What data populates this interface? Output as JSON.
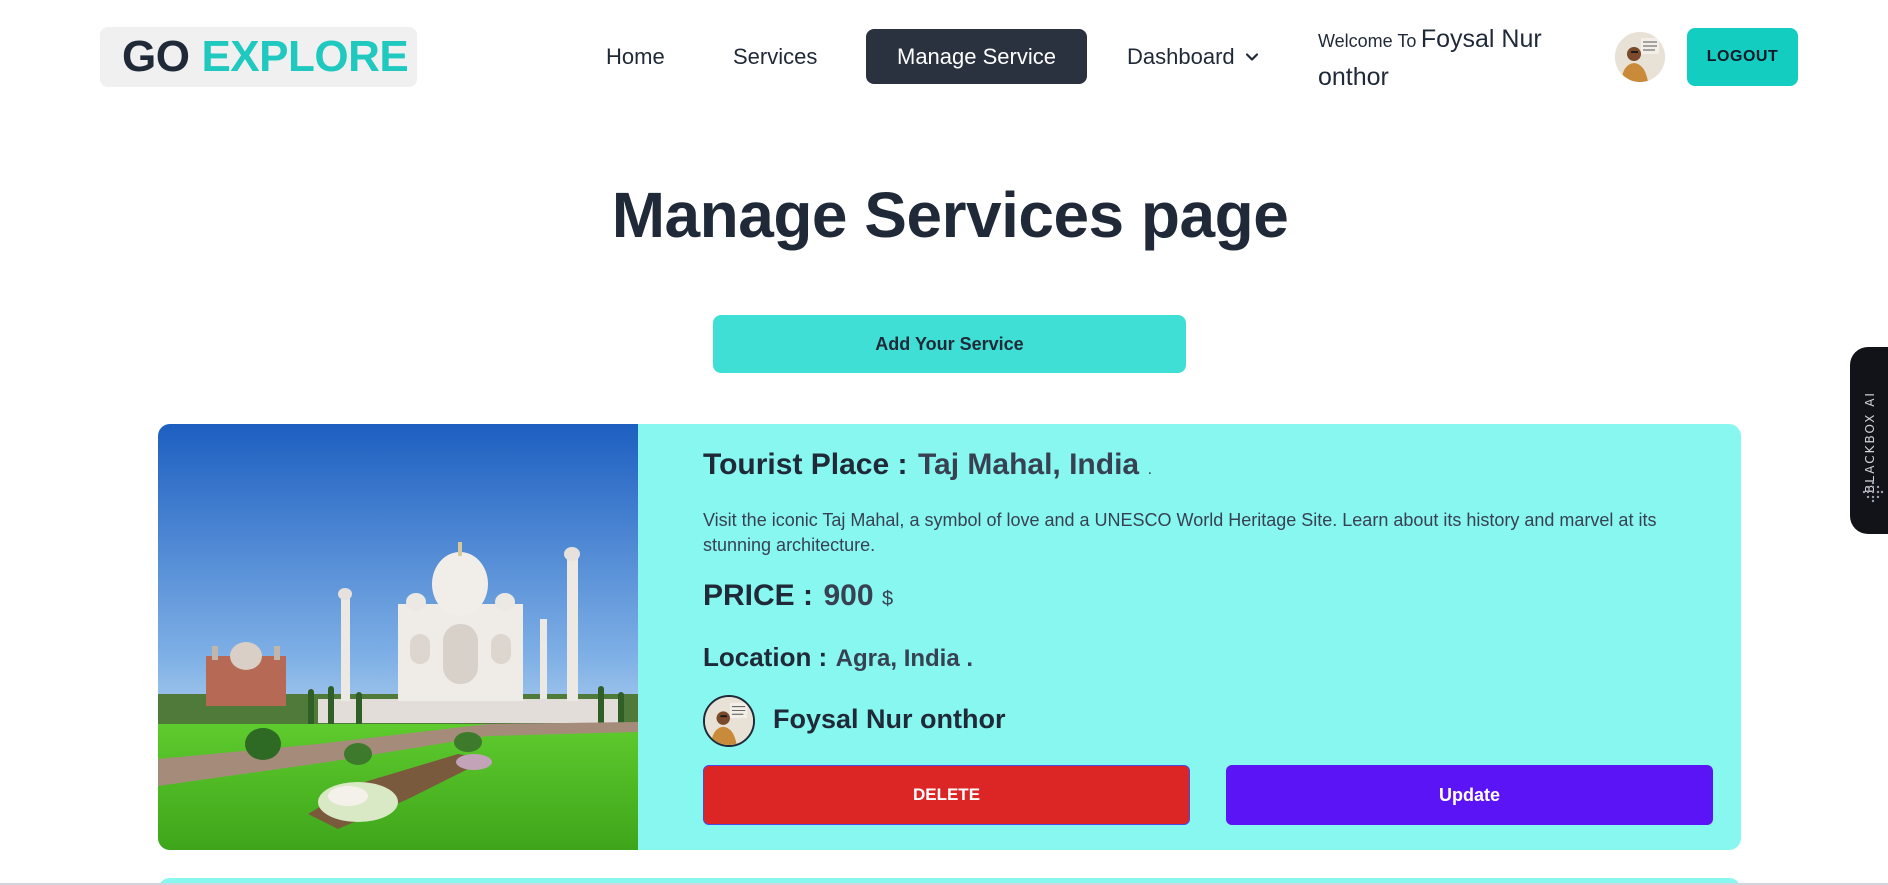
{
  "header": {
    "logo": {
      "part1": "GO",
      "part2": "EXPLORE"
    },
    "nav": [
      {
        "label": "Home"
      },
      {
        "label": "Services"
      },
      {
        "label": "Manage Service"
      },
      {
        "label": "Dashboard"
      }
    ],
    "welcome": {
      "prefix": "Welcome To",
      "user": "Foysal Nur onthor"
    },
    "logout_label": "LOGOUT"
  },
  "page": {
    "title": "Manage Services page",
    "add_button": "Add Your Service"
  },
  "service": {
    "place_label": "Tourist Place :",
    "place_value": "Taj Mahal, India",
    "place_suffix": ".",
    "description": "Visit the iconic Taj Mahal, a symbol of love and a UNESCO World Heritage Site. Learn about its history and marvel at its stunning architecture.",
    "price_label": "PRICE :",
    "price_value": "900",
    "price_unit": "$",
    "location_label": "Location :",
    "location_value": "Agra, India .",
    "owner_name": "Foysal Nur onthor",
    "delete_label": "DELETE",
    "update_label": "Update"
  },
  "side_tab": {
    "label": "BLACKBOX AI"
  },
  "colors": {
    "accent": "#12cdc0",
    "card_bg": "#88f7f0",
    "active_nav": "#2a323f",
    "delete": "#dc2626",
    "update": "#5b14f5"
  }
}
